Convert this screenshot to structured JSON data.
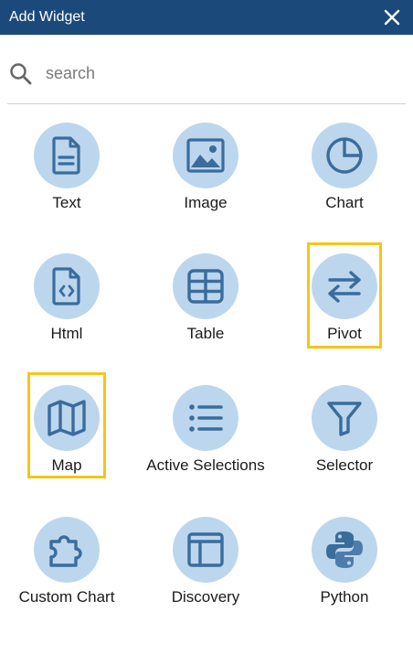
{
  "header": {
    "title": "Add Widget"
  },
  "search": {
    "placeholder": "search"
  },
  "colors": {
    "header_bg": "#1b4a7a",
    "icon_bg": "#bcd6ee",
    "icon_fg": "#3a6c9c",
    "highlight": "#f5c518"
  },
  "widgets": [
    {
      "label": "Text",
      "icon": "document-icon"
    },
    {
      "label": "Image",
      "icon": "image-icon"
    },
    {
      "label": "Chart",
      "icon": "pie-chart-icon"
    },
    {
      "label": "Html",
      "icon": "code-file-icon"
    },
    {
      "label": "Table",
      "icon": "table-icon"
    },
    {
      "label": "Pivot",
      "icon": "swap-arrows-icon",
      "highlighted": true
    },
    {
      "label": "Map",
      "icon": "map-icon",
      "highlighted": true
    },
    {
      "label": "Active Selections",
      "icon": "list-icon"
    },
    {
      "label": "Selector",
      "icon": "filter-icon"
    },
    {
      "label": "Custom Chart",
      "icon": "puzzle-icon"
    },
    {
      "label": "Discovery",
      "icon": "layout-icon"
    },
    {
      "label": "Python",
      "icon": "python-icon"
    }
  ]
}
